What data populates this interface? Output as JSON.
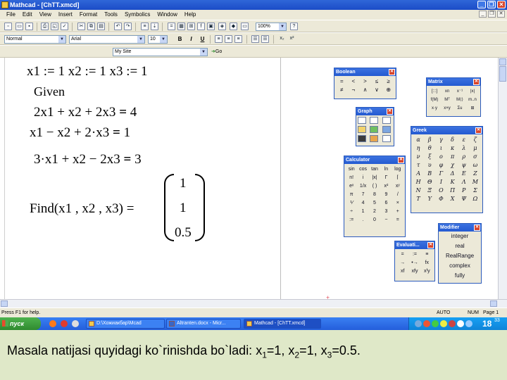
{
  "window": {
    "title": "Mathcad - [ChTT.xmcd]"
  },
  "menu": [
    "File",
    "Edit",
    "View",
    "Insert",
    "Format",
    "Tools",
    "Symbolics",
    "Window",
    "Help"
  ],
  "toolbar": {
    "style": "Normal",
    "font": "Arial",
    "font_size": "10",
    "zoom": "100%",
    "bold": "B",
    "italic": "I",
    "underline": "U",
    "site": "My Site",
    "go": "Go"
  },
  "worksheet": {
    "assign_line": "x1 := 1      x2 := 1    x3 := 1",
    "given": "Given",
    "eq1_lhs": "2x1 + x2 + 2x3",
    "eq1_rhs": "4",
    "eq2_lhs": "x1 − x2 + 2·x3",
    "eq2_rhs": "1",
    "eq3_lhs": "3·x1 + x2 − 2x3",
    "eq3_rhs": "3",
    "eq_sign": "=",
    "find": "Find(x1 , x2 , x3) =",
    "result": [
      "1",
      "1",
      "0.5"
    ]
  },
  "palettes": {
    "boolean": {
      "title": "Boolean",
      "row1": [
        "=",
        "<",
        ">",
        "≤",
        "≥"
      ],
      "row2": [
        "≠",
        "¬",
        "∧",
        "∨",
        "⊕"
      ]
    },
    "matrix": {
      "title": "Matrix",
      "row1": [
        "[:::]",
        "xn",
        "x⁻¹",
        "|x|"
      ],
      "row2": [
        "f(M)",
        "Mᵀ",
        "M⟨⟩",
        "m..n"
      ],
      "row3": [
        "x·y",
        "x×y",
        "Σu",
        "⊞"
      ]
    },
    "graph": {
      "title": "Graph"
    },
    "greek": {
      "title": "Greek",
      "lower": [
        "α",
        "β",
        "γ",
        "δ",
        "ε",
        "ζ",
        "η",
        "θ",
        "ι",
        "κ",
        "λ",
        "μ",
        "ν",
        "ξ",
        "ο",
        "π",
        "ρ",
        "σ",
        "τ",
        "υ",
        "φ",
        "χ",
        "ψ",
        "ω"
      ],
      "upper": [
        "Α",
        "Β",
        "Γ",
        "Δ",
        "Ε",
        "Ζ",
        "Η",
        "Θ",
        "Ι",
        "Κ",
        "Λ",
        "Μ",
        "Ν",
        "Ξ",
        "Ο",
        "Π",
        "Ρ",
        "Σ",
        "Τ",
        "Υ",
        "Φ",
        "Χ",
        "Ψ",
        "Ω"
      ]
    },
    "calculator": {
      "title": "Calculator",
      "rows": [
        [
          "sin",
          "cos",
          "tan",
          "ln",
          "log"
        ],
        [
          "n!",
          "i",
          "|x|",
          "Γ",
          "⌈"
        ],
        [
          "eˣ",
          "1/x",
          "( )",
          "x²",
          "xʸ"
        ],
        [
          "π",
          "7",
          "8",
          "9",
          "/"
        ],
        [
          "⅟",
          "4",
          "5",
          "6",
          "×"
        ],
        [
          "÷",
          "1",
          "2",
          "3",
          "+"
        ],
        [
          ":=",
          ".",
          "0",
          "−",
          "="
        ]
      ]
    },
    "evaluation": {
      "title": "Evaluati...",
      "row1": [
        "=",
        ":=",
        "≡"
      ],
      "row2": [
        "→",
        "•→",
        "fx"
      ],
      "row3": [
        "xf",
        "xfy",
        "xᶠy"
      ]
    },
    "modifier": {
      "title": "Modifier",
      "items": [
        "integer",
        "real",
        "RealRange",
        "complex",
        "fully"
      ]
    }
  },
  "statusbar": {
    "help": "Press F1 for help.",
    "auto": "AUTO",
    "num": "NUM",
    "page": "Page 1"
  },
  "taskbar": {
    "start": "пуск",
    "tasks": [
      "D:\\Хожиакбар\\Mcad",
      "Altranten.docx - Micr...",
      "Mathcad - [ChTT.xmcd]"
    ],
    "clock": "18",
    "clock_min": "33"
  },
  "caption": {
    "text": "Masala natijasi quyidagi ko`rinishda bo`ladi: x",
    "s1": "1",
    "v1": "=1,  x",
    "s2": "2",
    "v2": "=1,  x",
    "s3": "3",
    "v3": "=0.5."
  }
}
